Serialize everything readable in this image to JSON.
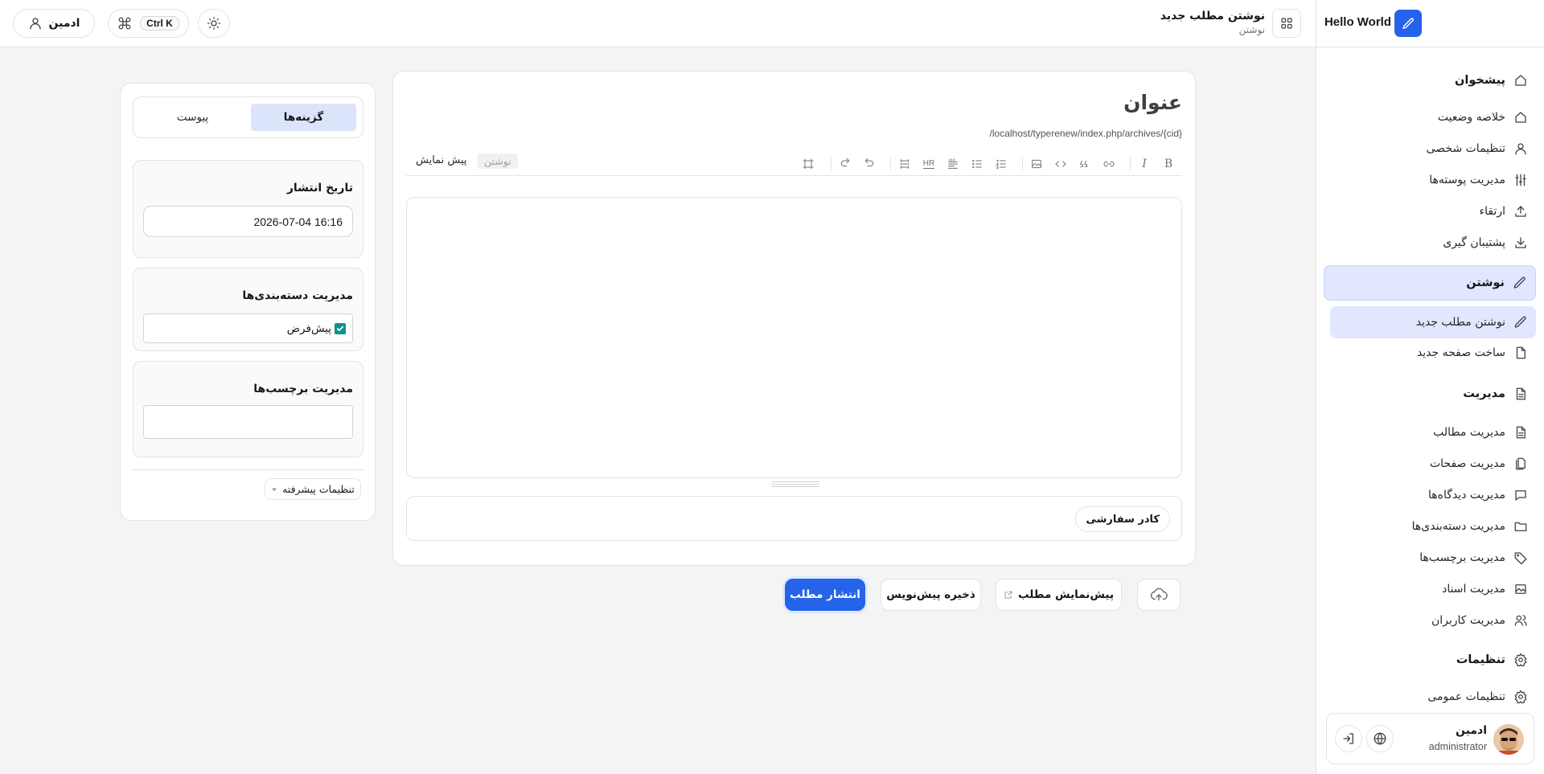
{
  "app": {
    "brand_name": "Hello World"
  },
  "topbar": {
    "page_title": "نوشتن مطلب جدید",
    "page_subtitle": "نوشتن",
    "user_label": "ادمین",
    "shortcut": "Ctrl K"
  },
  "sidebar": {
    "items": [
      {
        "label": "پیشخوان",
        "icon": "home-icon",
        "type": "group"
      },
      {
        "label": "خلاصه وضعیت",
        "icon": "home-icon"
      },
      {
        "label": "تنظیمات شخصی",
        "icon": "user-icon"
      },
      {
        "label": "مدیریت پوسته‌ها",
        "icon": "sliders-icon"
      },
      {
        "label": "ارتقاء",
        "icon": "upload-icon"
      },
      {
        "label": "پشتیبان گیری",
        "icon": "download-icon"
      },
      {
        "label": "نوشتن",
        "icon": "pen-icon",
        "type": "group",
        "active": true
      },
      {
        "label": "نوشتن مطلب جدید",
        "icon": "pen-icon",
        "active": true
      },
      {
        "label": "ساخت صفحه جدید",
        "icon": "file-icon"
      },
      {
        "label": "مدیریت",
        "icon": "file-text-icon",
        "type": "group"
      },
      {
        "label": "مدیریت مطالب",
        "icon": "file-text-icon"
      },
      {
        "label": "مدیریت صفحات",
        "icon": "files-icon"
      },
      {
        "label": "مدیریت دیدگاه‌ها",
        "icon": "comment-icon"
      },
      {
        "label": "مدیریت دسته‌بندی‌ها",
        "icon": "folder-icon"
      },
      {
        "label": "مدیریت برچسب‌ها",
        "icon": "tag-icon"
      },
      {
        "label": "مدیریت اسناد",
        "icon": "image-icon"
      },
      {
        "label": "مدیریت کاربران",
        "icon": "users-icon"
      },
      {
        "label": "تنظیمات",
        "icon": "gear-icon",
        "type": "group"
      },
      {
        "label": "تنظیمات عمومی",
        "icon": "gear-icon"
      }
    ],
    "user": {
      "name": "ادمین",
      "role": "administrator"
    }
  },
  "editor": {
    "title_placeholder": "عنوان",
    "permalink": "/localhost/typerenew/index.php/archives/{cid}",
    "mode_write": "نوشتن",
    "mode_preview": "پیش نمایش",
    "toolbar": [
      "bold",
      "italic",
      "link",
      "quote",
      "code",
      "image",
      "ordered-list",
      "unordered-list",
      "heading",
      "hr",
      "more",
      "undo",
      "redo",
      "fullscreen"
    ],
    "toolbar_labels": {
      "bold": "B",
      "italic": "I",
      "hr": "HR"
    },
    "body": "",
    "custom_field_button": "کادر سفارشی"
  },
  "actions": {
    "publish": "انتشار مطلب",
    "save_draft": "ذخیره پیش‌نویس",
    "preview": "پیش‌نمایش مطلب"
  },
  "options": {
    "tab_options": "گزینه‌ها",
    "tab_attachments": "پیوست",
    "publish_date_label": "تاریخ انتشار",
    "publish_date_value": "2026-07-04 16:16",
    "categories_label": "مدیریت دسته‌بندی‌ها",
    "categories": [
      {
        "label": "پیش‌فرض",
        "checked": true
      }
    ],
    "tags_label": "مدیریت برچسب‌ها",
    "tags_value": "",
    "advanced_label": "تنظیمات پیشرفته"
  },
  "colors": {
    "accent": "#2563eb",
    "active_bg": "#e0e7ff",
    "checkbox": "#0d9488"
  }
}
